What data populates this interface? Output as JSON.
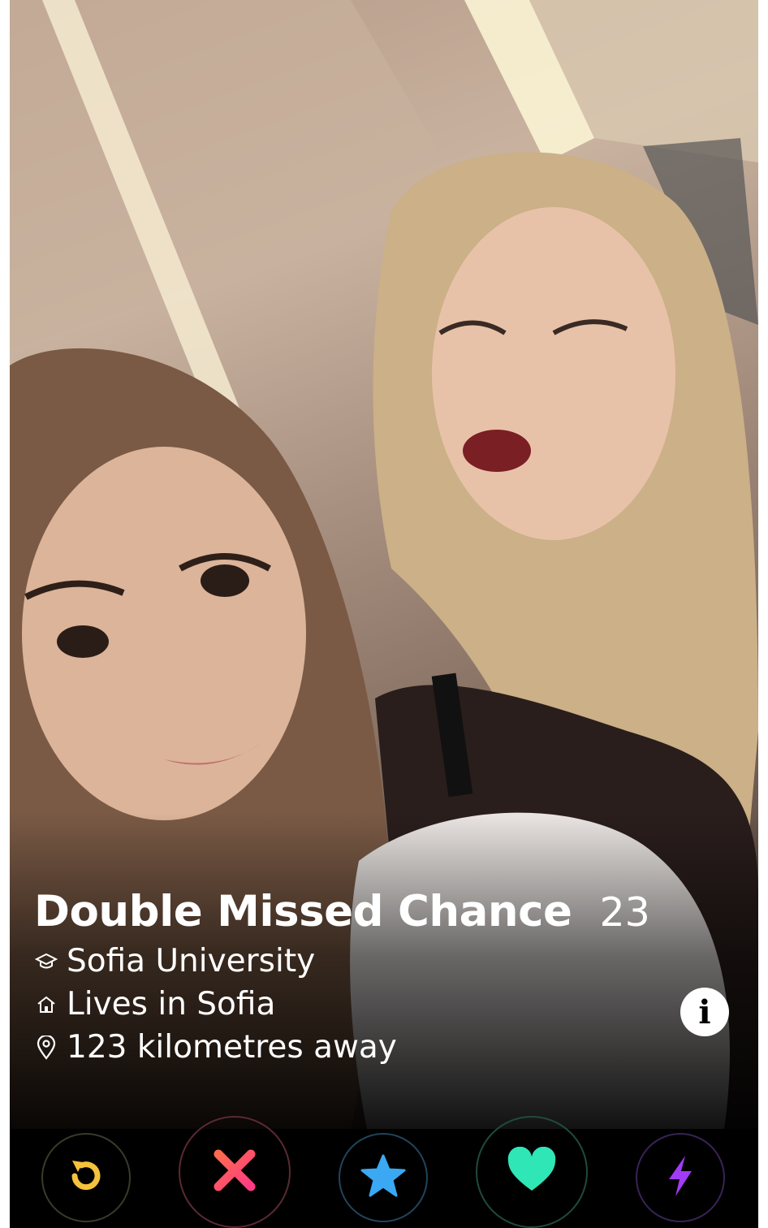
{
  "profile": {
    "name": "Double Missed Chance",
    "age": "23",
    "school": "Sofia University",
    "lives": "Lives in Sofia",
    "distance": "123 kilometres away"
  },
  "icons": {
    "school": "graduation-cap-icon",
    "home": "house-icon",
    "location": "map-pin-icon",
    "info": "info-icon"
  },
  "actions": [
    {
      "name": "rewind",
      "icon": "rewind-icon",
      "color": "#f5c23b"
    },
    {
      "name": "nope",
      "icon": "close-icon",
      "color": "#fd4d6f"
    },
    {
      "name": "super-like",
      "icon": "star-icon",
      "color": "#3aa8f2"
    },
    {
      "name": "like",
      "icon": "heart-icon",
      "color": "#2fe6b6"
    },
    {
      "name": "boost",
      "icon": "lightning-icon",
      "color": "#a23bf5"
    }
  ],
  "colors": {
    "rewind": "#f5c23b",
    "nope": "#fd4d6f",
    "super_like": "#3aa8f2",
    "like": "#2fe6b6",
    "boost": "#a23bf5"
  }
}
